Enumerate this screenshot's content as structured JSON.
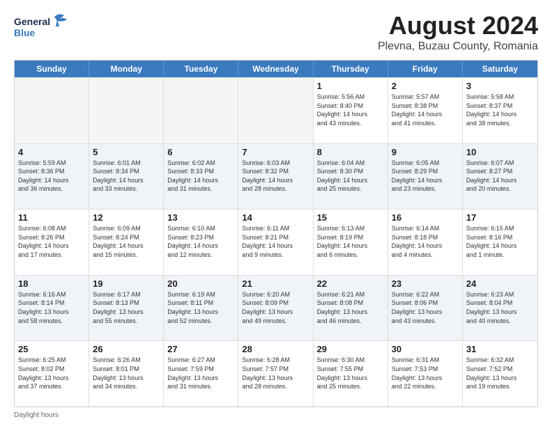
{
  "header": {
    "logo_general": "General",
    "logo_blue": "Blue",
    "main_title": "August 2024",
    "subtitle": "Plevna, Buzau County, Romania"
  },
  "calendar": {
    "days_of_week": [
      "Sunday",
      "Monday",
      "Tuesday",
      "Wednesday",
      "Thursday",
      "Friday",
      "Saturday"
    ],
    "rows": [
      [
        {
          "day": "",
          "content": "",
          "empty": true
        },
        {
          "day": "",
          "content": "",
          "empty": true
        },
        {
          "day": "",
          "content": "",
          "empty": true
        },
        {
          "day": "",
          "content": "",
          "empty": true
        },
        {
          "day": "1",
          "content": "Sunrise: 5:56 AM\nSunset: 8:40 PM\nDaylight: 14 hours\nand 43 minutes.",
          "empty": false
        },
        {
          "day": "2",
          "content": "Sunrise: 5:57 AM\nSunset: 8:38 PM\nDaylight: 14 hours\nand 41 minutes.",
          "empty": false
        },
        {
          "day": "3",
          "content": "Sunrise: 5:58 AM\nSunset: 8:37 PM\nDaylight: 14 hours\nand 38 minutes.",
          "empty": false
        }
      ],
      [
        {
          "day": "4",
          "content": "Sunrise: 5:59 AM\nSunset: 8:36 PM\nDaylight: 14 hours\nand 36 minutes.",
          "empty": false
        },
        {
          "day": "5",
          "content": "Sunrise: 6:01 AM\nSunset: 8:34 PM\nDaylight: 14 hours\nand 33 minutes.",
          "empty": false
        },
        {
          "day": "6",
          "content": "Sunrise: 6:02 AM\nSunset: 8:33 PM\nDaylight: 14 hours\nand 31 minutes.",
          "empty": false
        },
        {
          "day": "7",
          "content": "Sunrise: 6:03 AM\nSunset: 8:32 PM\nDaylight: 14 hours\nand 28 minutes.",
          "empty": false
        },
        {
          "day": "8",
          "content": "Sunrise: 6:04 AM\nSunset: 8:30 PM\nDaylight: 14 hours\nand 25 minutes.",
          "empty": false
        },
        {
          "day": "9",
          "content": "Sunrise: 6:05 AM\nSunset: 8:29 PM\nDaylight: 14 hours\nand 23 minutes.",
          "empty": false
        },
        {
          "day": "10",
          "content": "Sunrise: 6:07 AM\nSunset: 8:27 PM\nDaylight: 14 hours\nand 20 minutes.",
          "empty": false
        }
      ],
      [
        {
          "day": "11",
          "content": "Sunrise: 6:08 AM\nSunset: 8:26 PM\nDaylight: 14 hours\nand 17 minutes.",
          "empty": false
        },
        {
          "day": "12",
          "content": "Sunrise: 6:09 AM\nSunset: 8:24 PM\nDaylight: 14 hours\nand 15 minutes.",
          "empty": false
        },
        {
          "day": "13",
          "content": "Sunrise: 6:10 AM\nSunset: 8:23 PM\nDaylight: 14 hours\nand 12 minutes.",
          "empty": false
        },
        {
          "day": "14",
          "content": "Sunrise: 6:11 AM\nSunset: 8:21 PM\nDaylight: 14 hours\nand 9 minutes.",
          "empty": false
        },
        {
          "day": "15",
          "content": "Sunrise: 6:13 AM\nSunset: 8:19 PM\nDaylight: 14 hours\nand 6 minutes.",
          "empty": false
        },
        {
          "day": "16",
          "content": "Sunrise: 6:14 AM\nSunset: 8:18 PM\nDaylight: 14 hours\nand 4 minutes.",
          "empty": false
        },
        {
          "day": "17",
          "content": "Sunrise: 6:15 AM\nSunset: 8:16 PM\nDaylight: 14 hours\nand 1 minute.",
          "empty": false
        }
      ],
      [
        {
          "day": "18",
          "content": "Sunrise: 6:16 AM\nSunset: 8:14 PM\nDaylight: 13 hours\nand 58 minutes.",
          "empty": false
        },
        {
          "day": "19",
          "content": "Sunrise: 6:17 AM\nSunset: 8:13 PM\nDaylight: 13 hours\nand 55 minutes.",
          "empty": false
        },
        {
          "day": "20",
          "content": "Sunrise: 6:19 AM\nSunset: 8:11 PM\nDaylight: 13 hours\nand 52 minutes.",
          "empty": false
        },
        {
          "day": "21",
          "content": "Sunrise: 6:20 AM\nSunset: 8:09 PM\nDaylight: 13 hours\nand 49 minutes.",
          "empty": false
        },
        {
          "day": "22",
          "content": "Sunrise: 6:21 AM\nSunset: 8:08 PM\nDaylight: 13 hours\nand 46 minutes.",
          "empty": false
        },
        {
          "day": "23",
          "content": "Sunrise: 6:22 AM\nSunset: 8:06 PM\nDaylight: 13 hours\nand 43 minutes.",
          "empty": false
        },
        {
          "day": "24",
          "content": "Sunrise: 6:23 AM\nSunset: 8:04 PM\nDaylight: 13 hours\nand 40 minutes.",
          "empty": false
        }
      ],
      [
        {
          "day": "25",
          "content": "Sunrise: 6:25 AM\nSunset: 8:02 PM\nDaylight: 13 hours\nand 37 minutes.",
          "empty": false
        },
        {
          "day": "26",
          "content": "Sunrise: 6:26 AM\nSunset: 8:01 PM\nDaylight: 13 hours\nand 34 minutes.",
          "empty": false
        },
        {
          "day": "27",
          "content": "Sunrise: 6:27 AM\nSunset: 7:59 PM\nDaylight: 13 hours\nand 31 minutes.",
          "empty": false
        },
        {
          "day": "28",
          "content": "Sunrise: 6:28 AM\nSunset: 7:57 PM\nDaylight: 13 hours\nand 28 minutes.",
          "empty": false
        },
        {
          "day": "29",
          "content": "Sunrise: 6:30 AM\nSunset: 7:55 PM\nDaylight: 13 hours\nand 25 minutes.",
          "empty": false
        },
        {
          "day": "30",
          "content": "Sunrise: 6:31 AM\nSunset: 7:53 PM\nDaylight: 13 hours\nand 22 minutes.",
          "empty": false
        },
        {
          "day": "31",
          "content": "Sunrise: 6:32 AM\nSunset: 7:52 PM\nDaylight: 13 hours\nand 19 minutes.",
          "empty": false
        }
      ]
    ]
  },
  "footer": {
    "text": "Daylight hours"
  }
}
